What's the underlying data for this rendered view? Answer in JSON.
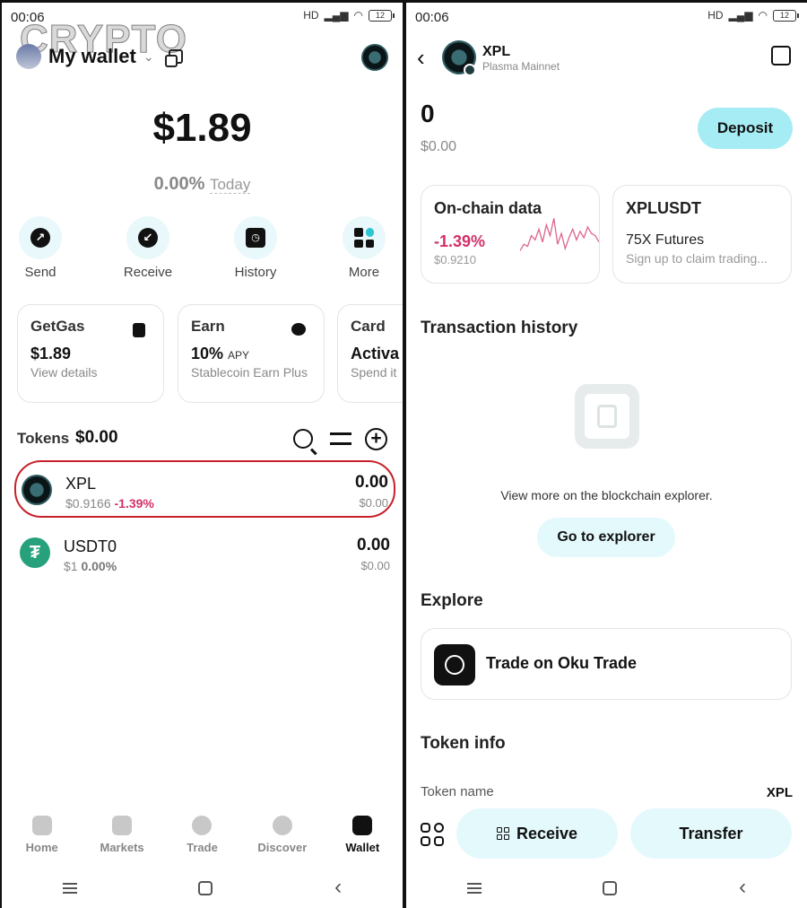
{
  "watermark": "CRYPTO",
  "left": {
    "status": {
      "time": "00:06",
      "network": "HD",
      "battery": "12"
    },
    "wallet_name": "My wallet",
    "balance": "$1.89",
    "change_pct": "0.00%",
    "change_label": "Today",
    "actions": [
      {
        "label": "Send"
      },
      {
        "label": "Receive"
      },
      {
        "label": "History"
      },
      {
        "label": "More"
      }
    ],
    "cards": [
      {
        "title": "GetGas",
        "value": "$1.89",
        "value_suffix": "",
        "sub": "View details"
      },
      {
        "title": "Earn",
        "value": "10%",
        "value_suffix": "APY",
        "sub": "Stablecoin Earn Plus"
      },
      {
        "title": "Card",
        "value": "Activa",
        "value_suffix": "",
        "sub": "Spend it"
      }
    ],
    "tokens_label": "Tokens",
    "tokens_total": "$0.00",
    "tokens": [
      {
        "name": "XPL",
        "price": "$0.9166",
        "change": "-1.39%",
        "amount": "0.00",
        "usd": "$0.00"
      },
      {
        "name": "USDT0",
        "price": "$1",
        "change": "0.00%",
        "amount": "0.00",
        "usd": "$0.00"
      }
    ],
    "nav": [
      {
        "label": "Home"
      },
      {
        "label": "Markets"
      },
      {
        "label": "Trade"
      },
      {
        "label": "Discover"
      },
      {
        "label": "Wallet"
      }
    ]
  },
  "right": {
    "status": {
      "time": "00:06",
      "network": "HD",
      "battery": "12"
    },
    "token_title": "XPL",
    "network_name": "Plasma Mainnet",
    "amount": "0",
    "amount_usd": "$0.00",
    "deposit_label": "Deposit",
    "onchain": {
      "title": "On-chain data",
      "change": "-1.39%",
      "price": "$0.9210"
    },
    "futures": {
      "title": "XPLUSDT",
      "line1": "75X Futures",
      "line2": "Sign up to claim trading..."
    },
    "tx_history_title": "Transaction history",
    "explorer_text": "View more on the blockchain explorer.",
    "explorer_btn": "Go to explorer",
    "explore_title": "Explore",
    "oku_label": "Trade on Oku Trade",
    "token_info_title": "Token info",
    "token_name_label": "Token name",
    "token_name_value": "XPL",
    "receive_label": "Receive",
    "transfer_label": "Transfer"
  },
  "colors": {
    "accent": "#a6ecf4",
    "negative": "#d2306a",
    "highlight_border": "#c8202b"
  },
  "sparkline": [
    0.2,
    0.35,
    0.3,
    0.55,
    0.45,
    0.7,
    0.4,
    0.8,
    0.55,
    0.95,
    0.35,
    0.6,
    0.25,
    0.5,
    0.7,
    0.45,
    0.65,
    0.5,
    0.75,
    0.6,
    0.55,
    0.4
  ]
}
